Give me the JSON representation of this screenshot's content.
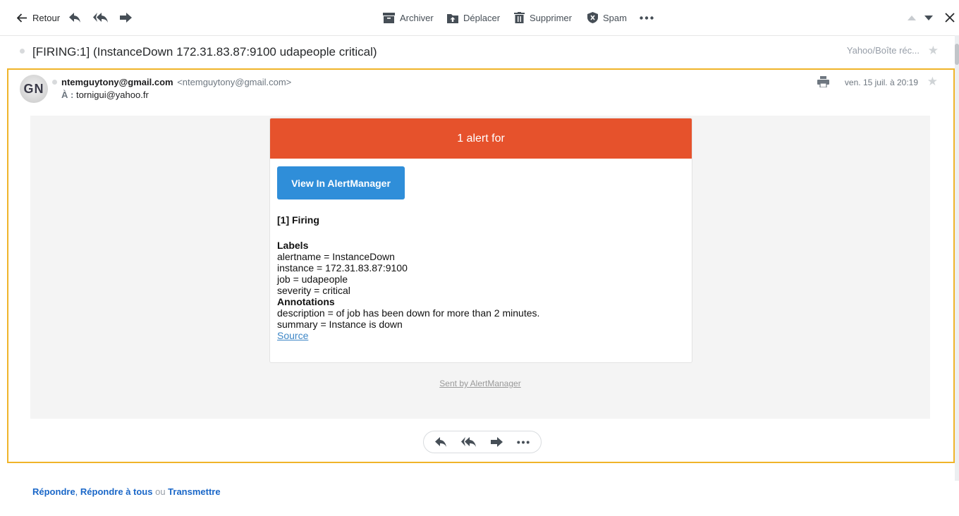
{
  "toolbar": {
    "back_label": "Retour",
    "archive_label": "Archiver",
    "move_label": "Déplacer",
    "delete_label": "Supprimer",
    "spam_label": "Spam"
  },
  "subject": {
    "title": "[FIRING:1] (InstanceDown 172.31.83.87:9100 udapeople critical)",
    "folder": "Yahoo/Boîte réc..."
  },
  "message": {
    "avatar_initials": "GN",
    "sender_name": "ntemguytony@gmail.com",
    "sender_address": "<ntemguytony@gmail.com>",
    "to_label": "À :",
    "to_address": "tornigui@yahoo.fr",
    "date": "ven. 15 juil. à 20:19"
  },
  "email_body": {
    "header": "1 alert for",
    "button_label": "View In AlertManager",
    "firing_title": "[1] Firing",
    "labels_title": "Labels",
    "labels": [
      "alertname = InstanceDown",
      "instance = 172.31.83.87:9100",
      "job = udapeople",
      "severity = critical"
    ],
    "annotations_title": "Annotations",
    "annotations": [
      "description = of job has been down for more than 2 minutes.",
      "summary = Instance is down"
    ],
    "source_link": "Source",
    "sent_by": "Sent by AlertManager",
    "header_color": "#e6522c",
    "button_color": "#2f8ed9"
  },
  "footer": {
    "reply": "Répondre",
    "sep1": ", ",
    "reply_all": "Répondre à tous",
    "or": " ou ",
    "forward": "Transmettre"
  },
  "colors": {
    "selection_border": "#f0b429",
    "link": "#1a67c8"
  }
}
